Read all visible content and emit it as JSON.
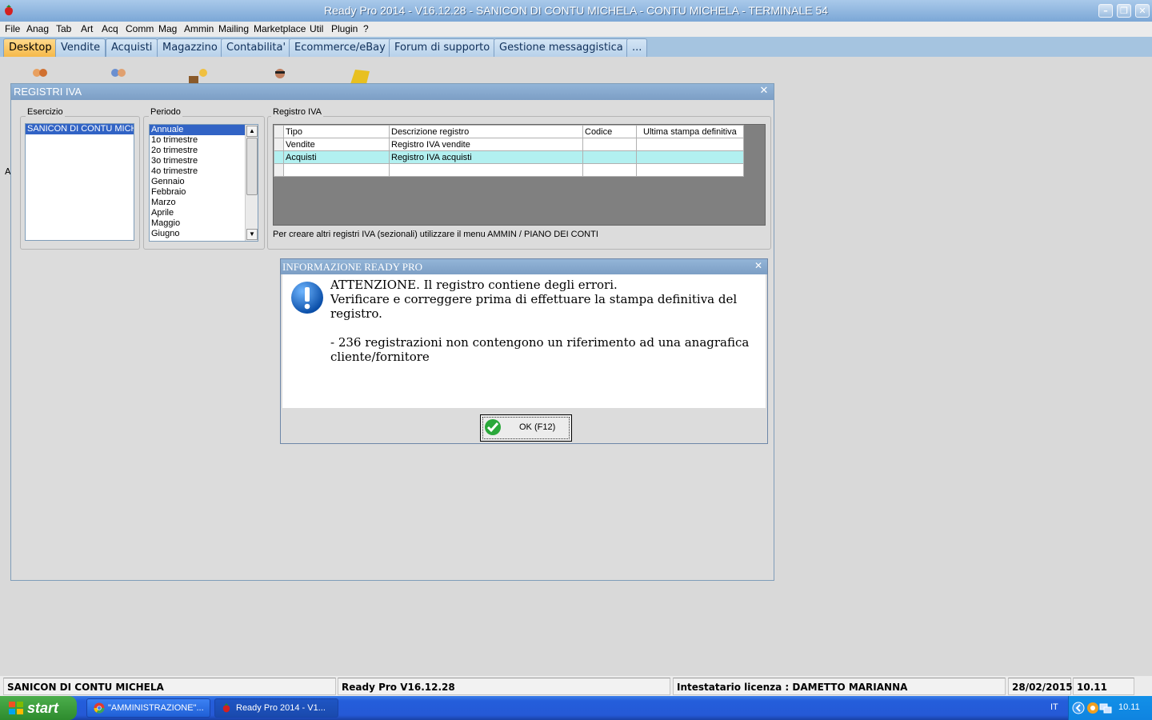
{
  "window": {
    "title": "Ready Pro 2014 - V16.12.28 - SANICON DI CONTU MICHELA - CONTU MICHELA - TERMINALE 54"
  },
  "menu": [
    "File",
    "Anag",
    "Tab",
    "Art",
    "Acq",
    "Comm",
    "Mag",
    "Ammin",
    "Mailing",
    "Marketplace",
    "Util",
    "Plugin",
    "?"
  ],
  "tabs": [
    "Desktop",
    "Vendite",
    "Acquisti",
    "Magazzino",
    "Contabilita'",
    "Ecommerce/eBay",
    "Forum di supporto",
    "Gestione messaggistica",
    "..."
  ],
  "active_tab": "Desktop",
  "registri": {
    "title": "REGISTRI IVA",
    "esercizio_label": "Esercizio",
    "esercizio_items": [
      "SANICON DI CONTU MICHELA"
    ],
    "periodo_label": "Periodo",
    "periodo_items": [
      "Annuale",
      "1o trimestre",
      "2o trimestre",
      "3o trimestre",
      "4o trimestre",
      "Gennaio",
      "Febbraio",
      "Marzo",
      "Aprile",
      "Maggio",
      "Giugno"
    ],
    "periodo_selected": "Annuale",
    "registro_label": "Registro IVA",
    "columns": [
      "Tipo",
      "Descrizione registro",
      "Codice",
      "Ultima stampa definitiva"
    ],
    "rows": [
      [
        "Vendite",
        "Registro IVA vendite",
        "",
        ""
      ],
      [
        "Acquisti",
        "Registro IVA acquisti",
        "",
        ""
      ]
    ],
    "note": "Per creare altri registri IVA (sezionali) utilizzare il menu AMMIN / PIANO DEI CONTI"
  },
  "info_dialog": {
    "title": "INFORMAZIONE READY PRO",
    "message": "ATTENZIONE. Il registro contiene degli errori.\nVerificare e correggere prima di effettuare la stampa definitiva del registro.\n\n- 236 registrazioni non contengono un riferimento ad una anagrafica cliente/fornitore",
    "ok_label": "OK (F12)"
  },
  "statusbar": {
    "company": "SANICON DI CONTU MICHELA",
    "version": "Ready Pro V16.12.28",
    "license": "Intestatario licenza : DAMETTO MARIANNA",
    "date": "28/02/2015",
    "time": "10.11"
  },
  "taskbar": {
    "start_label": "start",
    "tasks": [
      "\"AMMINISTRAZIONE\"...",
      "Ready Pro 2014 - V1..."
    ],
    "lang": "IT",
    "clock": "10.11"
  },
  "colors": {
    "titlebar": "#7ba7d6",
    "tab_active": "#f5b94a",
    "selection": "#3163c5",
    "row_highlight": "#b2f0f0",
    "taskbar": "#245edb",
    "start_button": "#2e8b2e"
  }
}
